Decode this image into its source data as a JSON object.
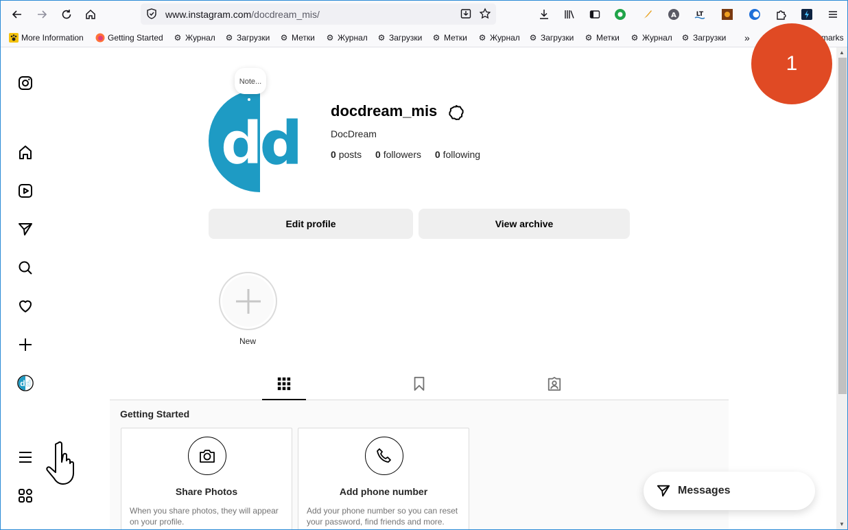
{
  "browser": {
    "url_host": "www.instagram.com",
    "url_path": "/docdream_mis/",
    "bookmarks": [
      {
        "label": "More Information",
        "icon": "paw-icon"
      },
      {
        "label": "Getting Started",
        "icon": "firefox-icon"
      },
      {
        "label": "Журнал",
        "icon": "gear-icon"
      },
      {
        "label": "Загрузки",
        "icon": "gear-icon"
      },
      {
        "label": "Метки",
        "icon": "gear-icon"
      },
      {
        "label": "Журнал",
        "icon": "gear-icon"
      },
      {
        "label": "Загрузки",
        "icon": "gear-icon"
      },
      {
        "label": "Метки",
        "icon": "gear-icon"
      },
      {
        "label": "Журнал",
        "icon": "gear-icon"
      },
      {
        "label": "Загрузки",
        "icon": "gear-icon"
      },
      {
        "label": "Метки",
        "icon": "gear-icon"
      },
      {
        "label": "Журнал",
        "icon": "gear-icon"
      },
      {
        "label": "Загрузки",
        "icon": "gear-icon"
      }
    ],
    "bookmarks_overflow": "marks"
  },
  "profile": {
    "note": "Note...",
    "avatar_text": "dd",
    "username": "docdream_mis",
    "full_name": "DocDream",
    "posts_count": "0",
    "posts_label": "posts",
    "followers_count": "0",
    "followers_label": "followers",
    "following_count": "0",
    "following_label": "following",
    "edit_profile_label": "Edit profile",
    "view_archive_label": "View archive",
    "new_highlight_label": "New"
  },
  "getting_started": {
    "title": "Getting Started",
    "cards": [
      {
        "title": "Share Photos",
        "description": "When you share photos, they will appear on your profile."
      },
      {
        "title": "Add phone number",
        "description": "Add your phone number so you can reset your password, find friends and more."
      }
    ]
  },
  "messages_label": "Messages",
  "step_badge": "1",
  "colors": {
    "avatar_blue": "#1e9bc4",
    "badge": "#e04a24"
  }
}
